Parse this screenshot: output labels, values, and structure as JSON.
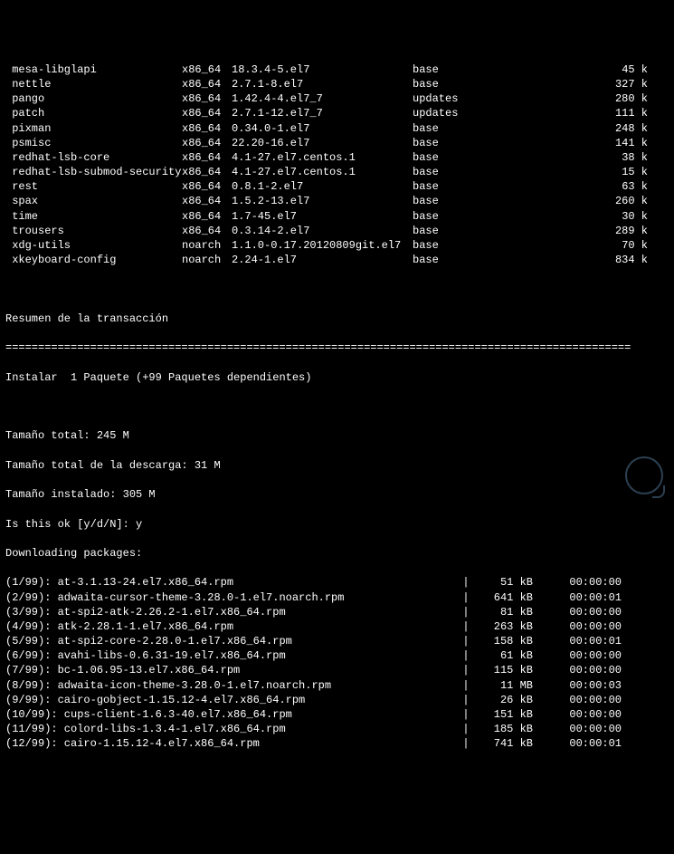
{
  "packages": [
    {
      "name": "mesa-libglapi",
      "arch": "x86_64",
      "ver": "18.3.4-5.el7",
      "repo": "base",
      "size": "45 k"
    },
    {
      "name": "nettle",
      "arch": "x86_64",
      "ver": "2.7.1-8.el7",
      "repo": "base",
      "size": "327 k"
    },
    {
      "name": "pango",
      "arch": "x86_64",
      "ver": "1.42.4-4.el7_7",
      "repo": "updates",
      "size": "280 k"
    },
    {
      "name": "patch",
      "arch": "x86_64",
      "ver": "2.7.1-12.el7_7",
      "repo": "updates",
      "size": "111 k"
    },
    {
      "name": "pixman",
      "arch": "x86_64",
      "ver": "0.34.0-1.el7",
      "repo": "base",
      "size": "248 k"
    },
    {
      "name": "psmisc",
      "arch": "x86_64",
      "ver": "22.20-16.el7",
      "repo": "base",
      "size": "141 k"
    },
    {
      "name": "redhat-lsb-core",
      "arch": "x86_64",
      "ver": "4.1-27.el7.centos.1",
      "repo": "base",
      "size": "38 k"
    },
    {
      "name": "redhat-lsb-submod-security",
      "arch": "x86_64",
      "ver": "4.1-27.el7.centos.1",
      "repo": "base",
      "size": "15 k"
    },
    {
      "name": "rest",
      "arch": "x86_64",
      "ver": "0.8.1-2.el7",
      "repo": "base",
      "size": "63 k"
    },
    {
      "name": "spax",
      "arch": "x86_64",
      "ver": "1.5.2-13.el7",
      "repo": "base",
      "size": "260 k"
    },
    {
      "name": "time",
      "arch": "x86_64",
      "ver": "1.7-45.el7",
      "repo": "base",
      "size": "30 k"
    },
    {
      "name": "trousers",
      "arch": "x86_64",
      "ver": "0.3.14-2.el7",
      "repo": "base",
      "size": "289 k"
    },
    {
      "name": "xdg-utils",
      "arch": "noarch",
      "ver": "1.1.0-0.17.20120809git.el7",
      "repo": "base",
      "size": "70 k"
    },
    {
      "name": "xkeyboard-config",
      "arch": "noarch",
      "ver": "2.24-1.el7",
      "repo": "base",
      "size": "834 k"
    }
  ],
  "summary_header": "Resumen de la transacción",
  "divider": "================================================================================================",
  "install_line": "Instalar  1 Paquete (+99 Paquetes dependientes)",
  "total_size": "Tamaño total: 245 M",
  "total_download": "Tamaño total de la descarga: 31 M",
  "installed_size": "Tamaño instalado: 305 M",
  "prompt_label": "Is this ok [y/d/N]: ",
  "prompt_answer": "y",
  "downloading_label": "Downloading packages:",
  "downloads": [
    {
      "idx": "(1/99):",
      "file": "at-3.1.13-24.el7.x86_64.rpm",
      "size": "51 kB",
      "time": "00:00:00"
    },
    {
      "idx": "(2/99):",
      "file": "adwaita-cursor-theme-3.28.0-1.el7.noarch.rpm",
      "size": "641 kB",
      "time": "00:00:01"
    },
    {
      "idx": "(3/99):",
      "file": "at-spi2-atk-2.26.2-1.el7.x86_64.rpm",
      "size": "81 kB",
      "time": "00:00:00"
    },
    {
      "idx": "(4/99):",
      "file": "atk-2.28.1-1.el7.x86_64.rpm",
      "size": "263 kB",
      "time": "00:00:00"
    },
    {
      "idx": "(5/99):",
      "file": "at-spi2-core-2.28.0-1.el7.x86_64.rpm",
      "size": "158 kB",
      "time": "00:00:01"
    },
    {
      "idx": "(6/99):",
      "file": "avahi-libs-0.6.31-19.el7.x86_64.rpm",
      "size": "61 kB",
      "time": "00:00:00"
    },
    {
      "idx": "(7/99):",
      "file": "bc-1.06.95-13.el7.x86_64.rpm",
      "size": "115 kB",
      "time": "00:00:00"
    },
    {
      "idx": "(8/99):",
      "file": "adwaita-icon-theme-3.28.0-1.el7.noarch.rpm",
      "size": "11 MB",
      "time": "00:00:03"
    },
    {
      "idx": "(9/99):",
      "file": "cairo-gobject-1.15.12-4.el7.x86_64.rpm",
      "size": "26 kB",
      "time": "00:00:00"
    },
    {
      "idx": "(10/99):",
      "file": "cups-client-1.6.3-40.el7.x86_64.rpm",
      "size": "151 kB",
      "time": "00:00:00"
    },
    {
      "idx": "(11/99):",
      "file": "colord-libs-1.3.4-1.el7.x86_64.rpm",
      "size": "185 kB",
      "time": "00:00:00"
    },
    {
      "idx": "(12/99):",
      "file": "cairo-1.15.12-4.el7.x86_64.rpm",
      "size": "741 kB",
      "time": "00:00:01"
    }
  ]
}
